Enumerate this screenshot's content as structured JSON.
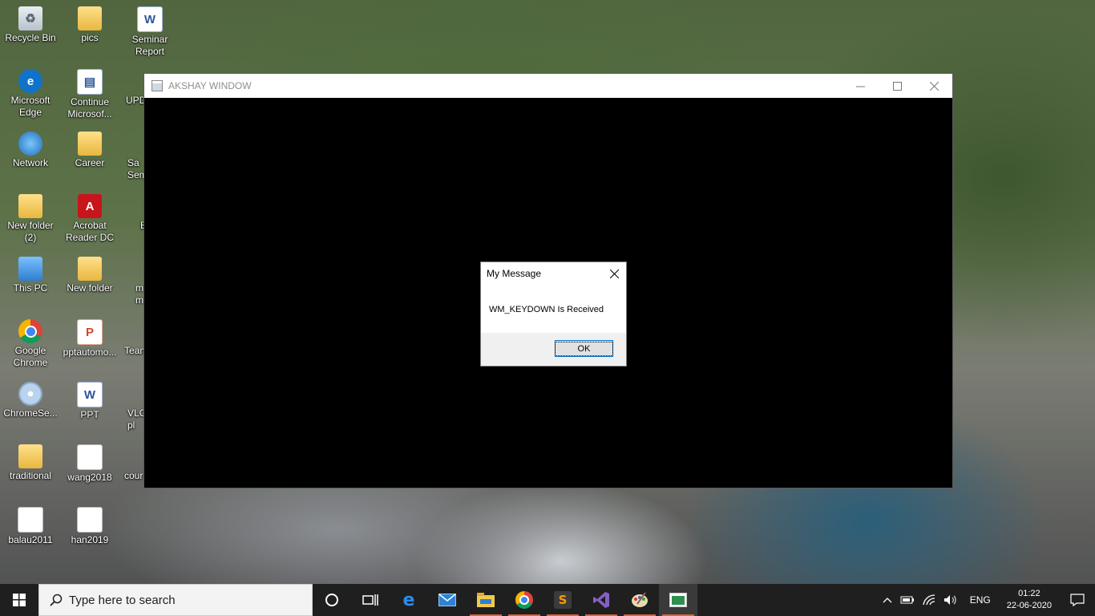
{
  "desktop": {
    "icons": [
      {
        "label": "Recycle Bin",
        "icon": "recycle-bin-icon"
      },
      {
        "label": "pics",
        "icon": "folder-icon"
      },
      {
        "label": "Seminar Report",
        "icon": "word-document-icon"
      },
      {
        "label": "Microsoft Edge",
        "icon": "edge-icon"
      },
      {
        "label": "Continue Microsof...",
        "icon": "shortcut-icon"
      },
      {
        "label": "UPD",
        "icon": "file-icon"
      },
      {
        "label": "Network",
        "icon": "network-icon"
      },
      {
        "label": "Career",
        "icon": "folder-icon"
      },
      {
        "label": "Sa Sem",
        "icon": "file-icon"
      },
      {
        "label": "New folder (2)",
        "icon": "folder-icon"
      },
      {
        "label": "Acrobat Reader DC",
        "icon": "acrobat-icon"
      },
      {
        "label": "E",
        "icon": "file-icon"
      },
      {
        "label": "This PC",
        "icon": "computer-icon"
      },
      {
        "label": "New folder",
        "icon": "folder-icon"
      },
      {
        "label": "m m",
        "icon": "file-icon"
      },
      {
        "label": "Google Chrome",
        "icon": "chrome-icon"
      },
      {
        "label": "pptautomo...",
        "icon": "powerpoint-icon"
      },
      {
        "label": "Team",
        "icon": "teams-icon"
      },
      {
        "label": "ChromeSe...",
        "icon": "disc-icon"
      },
      {
        "label": "PPT",
        "icon": "word-document-icon"
      },
      {
        "label": "VLC pl",
        "icon": "vlc-icon"
      },
      {
        "label": "traditional",
        "icon": "folder-icon"
      },
      {
        "label": "wang2018",
        "icon": "file-icon"
      },
      {
        "label": "cour",
        "icon": "file-icon"
      },
      {
        "label": "balau2011",
        "icon": "file-icon"
      },
      {
        "label": "han2019",
        "icon": "file-icon"
      }
    ]
  },
  "app_window": {
    "title": "AKSHAY WINDOW"
  },
  "message_box": {
    "title": "My Message",
    "text": "WM_KEYDOWN Is Received",
    "ok_label": "OK"
  },
  "taskbar": {
    "search_placeholder": "Type here to search",
    "language": "ENG",
    "time": "01:22",
    "date": "22-06-2020",
    "accent": "#cf6a45"
  }
}
